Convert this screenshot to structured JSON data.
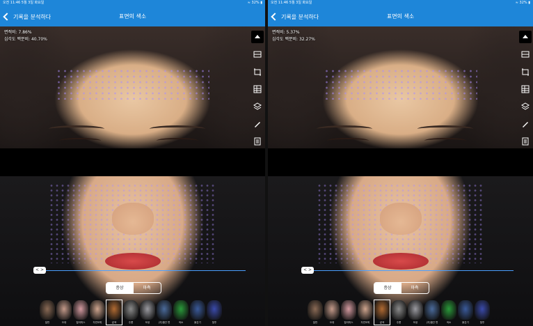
{
  "status": {
    "time": "오전 11:46  5월 3일 화요일",
    "right": "≈ 32% ▮"
  },
  "nav": {
    "back_label": "기록을 분석하다",
    "title": "표면의 색소"
  },
  "left": {
    "area_label": "면적비:",
    "area_value": "7.86%",
    "severity_label": "심각도 백분비:",
    "severity_value": "40.70%"
  },
  "right": {
    "area_label": "면적비:",
    "area_value": "5.37%",
    "severity_label": "심각도 백분비:",
    "severity_value": "32.27%"
  },
  "slider": {
    "handle_label": "< >"
  },
  "segmented": {
    "options": [
      "증상",
      "마측"
    ],
    "selected": 0
  },
  "thumbnails": {
    "labels": [
      "일반",
      "오대",
      "칼라피스",
      "자연모피",
      "갈색",
      "주름",
      "모공",
      "(자)혈관 변",
      "색소",
      "붉은기",
      "빛투"
    ],
    "colors": [
      "#8a6a55",
      "#c49a8a",
      "#d49aa0",
      "#cfa58e",
      "#b06a32",
      "#8a8a8a",
      "#9a9aa0",
      "#4a6a9a",
      "#2a9a3a",
      "#3a5a9a",
      "#3a4aaa"
    ],
    "selected": 4
  },
  "colors": {
    "accent": "#1e86d9",
    "slider": "#4aa0ff"
  }
}
